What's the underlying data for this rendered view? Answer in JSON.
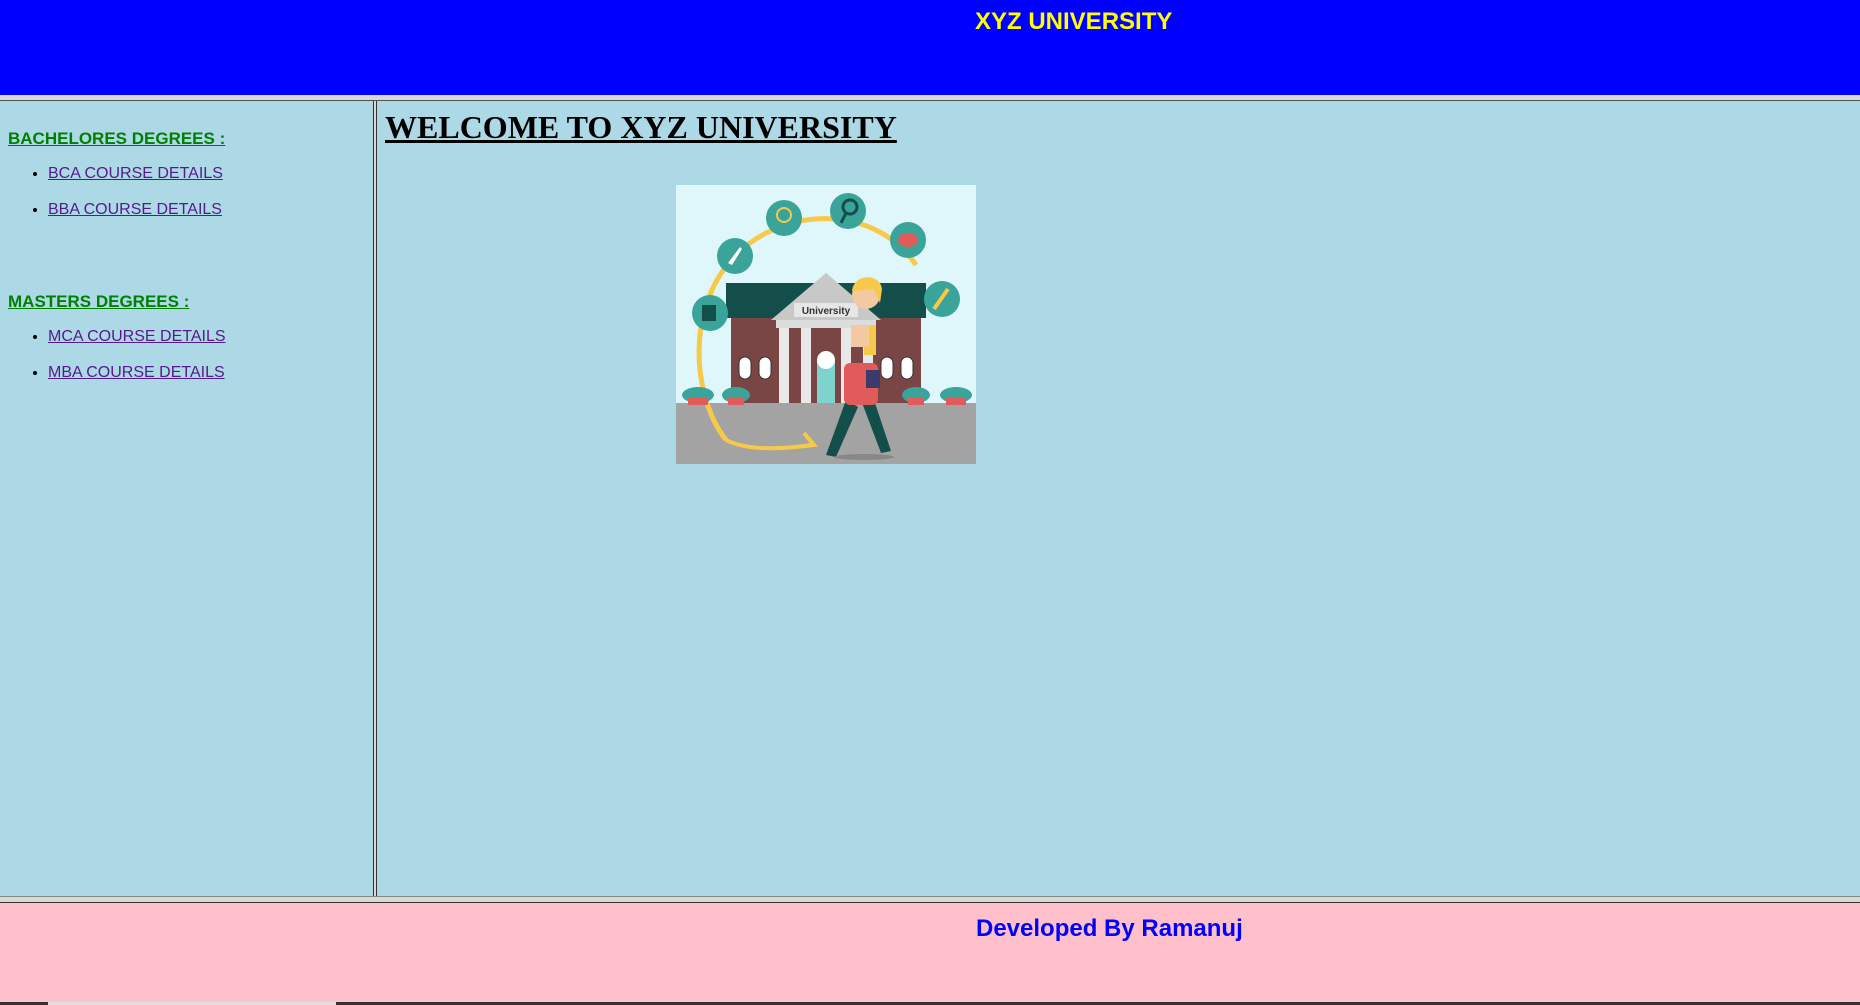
{
  "header": {
    "title": "XYZ UNIVERSITY"
  },
  "nav": {
    "bachelors": {
      "heading": "BACHELORES DEGREES :",
      "links": [
        "BCA COURSE DETAILS",
        "BBA COURSE DETAILS"
      ]
    },
    "masters": {
      "heading": "MASTERS DEGREES :",
      "links": [
        "MCA COURSE DETAILS",
        "MBA COURSE DETAILS"
      ]
    }
  },
  "main": {
    "heading": "WELCOME TO XYZ UNIVERSITY",
    "hero_sign": "University"
  },
  "footer": {
    "credit": "Developed By Ramanuj"
  },
  "colors": {
    "header_bg": "#0000ff",
    "header_text": "#ffff00",
    "frame_bg": "#add8e6",
    "nav_heading": "#008000",
    "link": "#551a8b",
    "footer_bg": "#ffc0cb",
    "footer_text": "#0000ff"
  }
}
